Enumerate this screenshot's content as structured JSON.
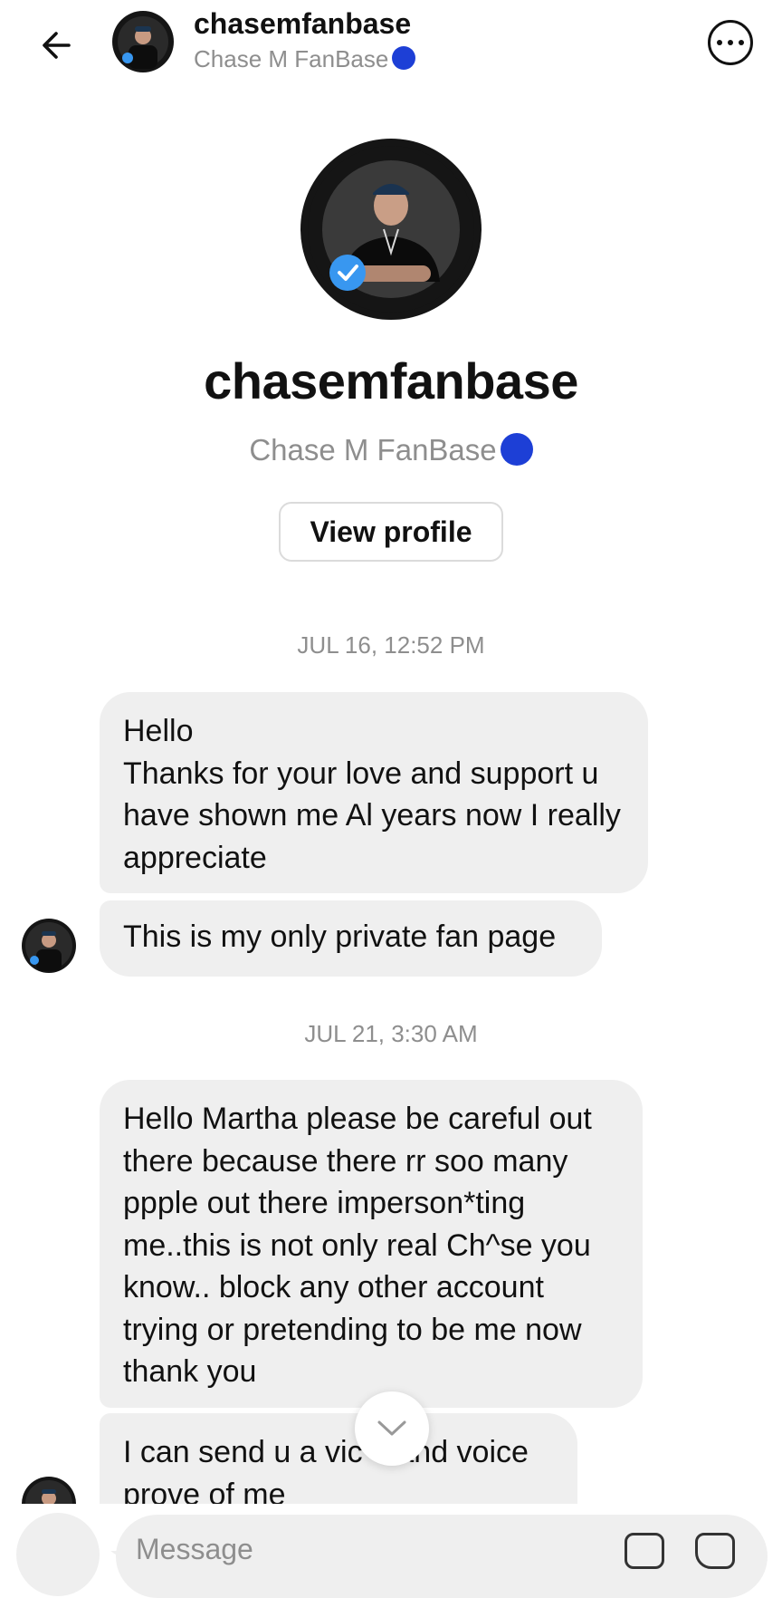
{
  "header": {
    "username": "chasemfanbase",
    "display_name": "Chase M FanBase"
  },
  "profile": {
    "username": "chasemfanbase",
    "display_name": "Chase M FanBase",
    "view_profile_label": "View profile"
  },
  "thread": {
    "groups": [
      {
        "timestamp": "JUL 16, 12:52 PM",
        "messages": [
          "Hello\nThanks for your love and support u have shown me Al years now I really appreciate",
          "This is my only private fan page"
        ]
      },
      {
        "timestamp": "JUL 21, 3:30 AM",
        "messages": [
          "Hello Martha please be careful out there because there rr soo many ppple out there imperson*ting me..this is not only real Ch^se you know.. block any other account trying or pretending to be me now thank you",
          "I can send u a vic    and voice prove of me"
        ]
      }
    ]
  },
  "composer": {
    "placeholder": "Message"
  },
  "icons": {
    "back": "arrow-left-icon",
    "more": "more-options-icon",
    "verified": "verified-badge-icon",
    "scroll": "chevron-down-icon",
    "gallery": "gallery-icon",
    "sticker": "sticker-icon"
  },
  "colors": {
    "verified_blue": "#3897f0",
    "emoji_blue": "#1d3fd6",
    "bubble": "#efefef",
    "secondary_text": "#8e8e8e"
  }
}
